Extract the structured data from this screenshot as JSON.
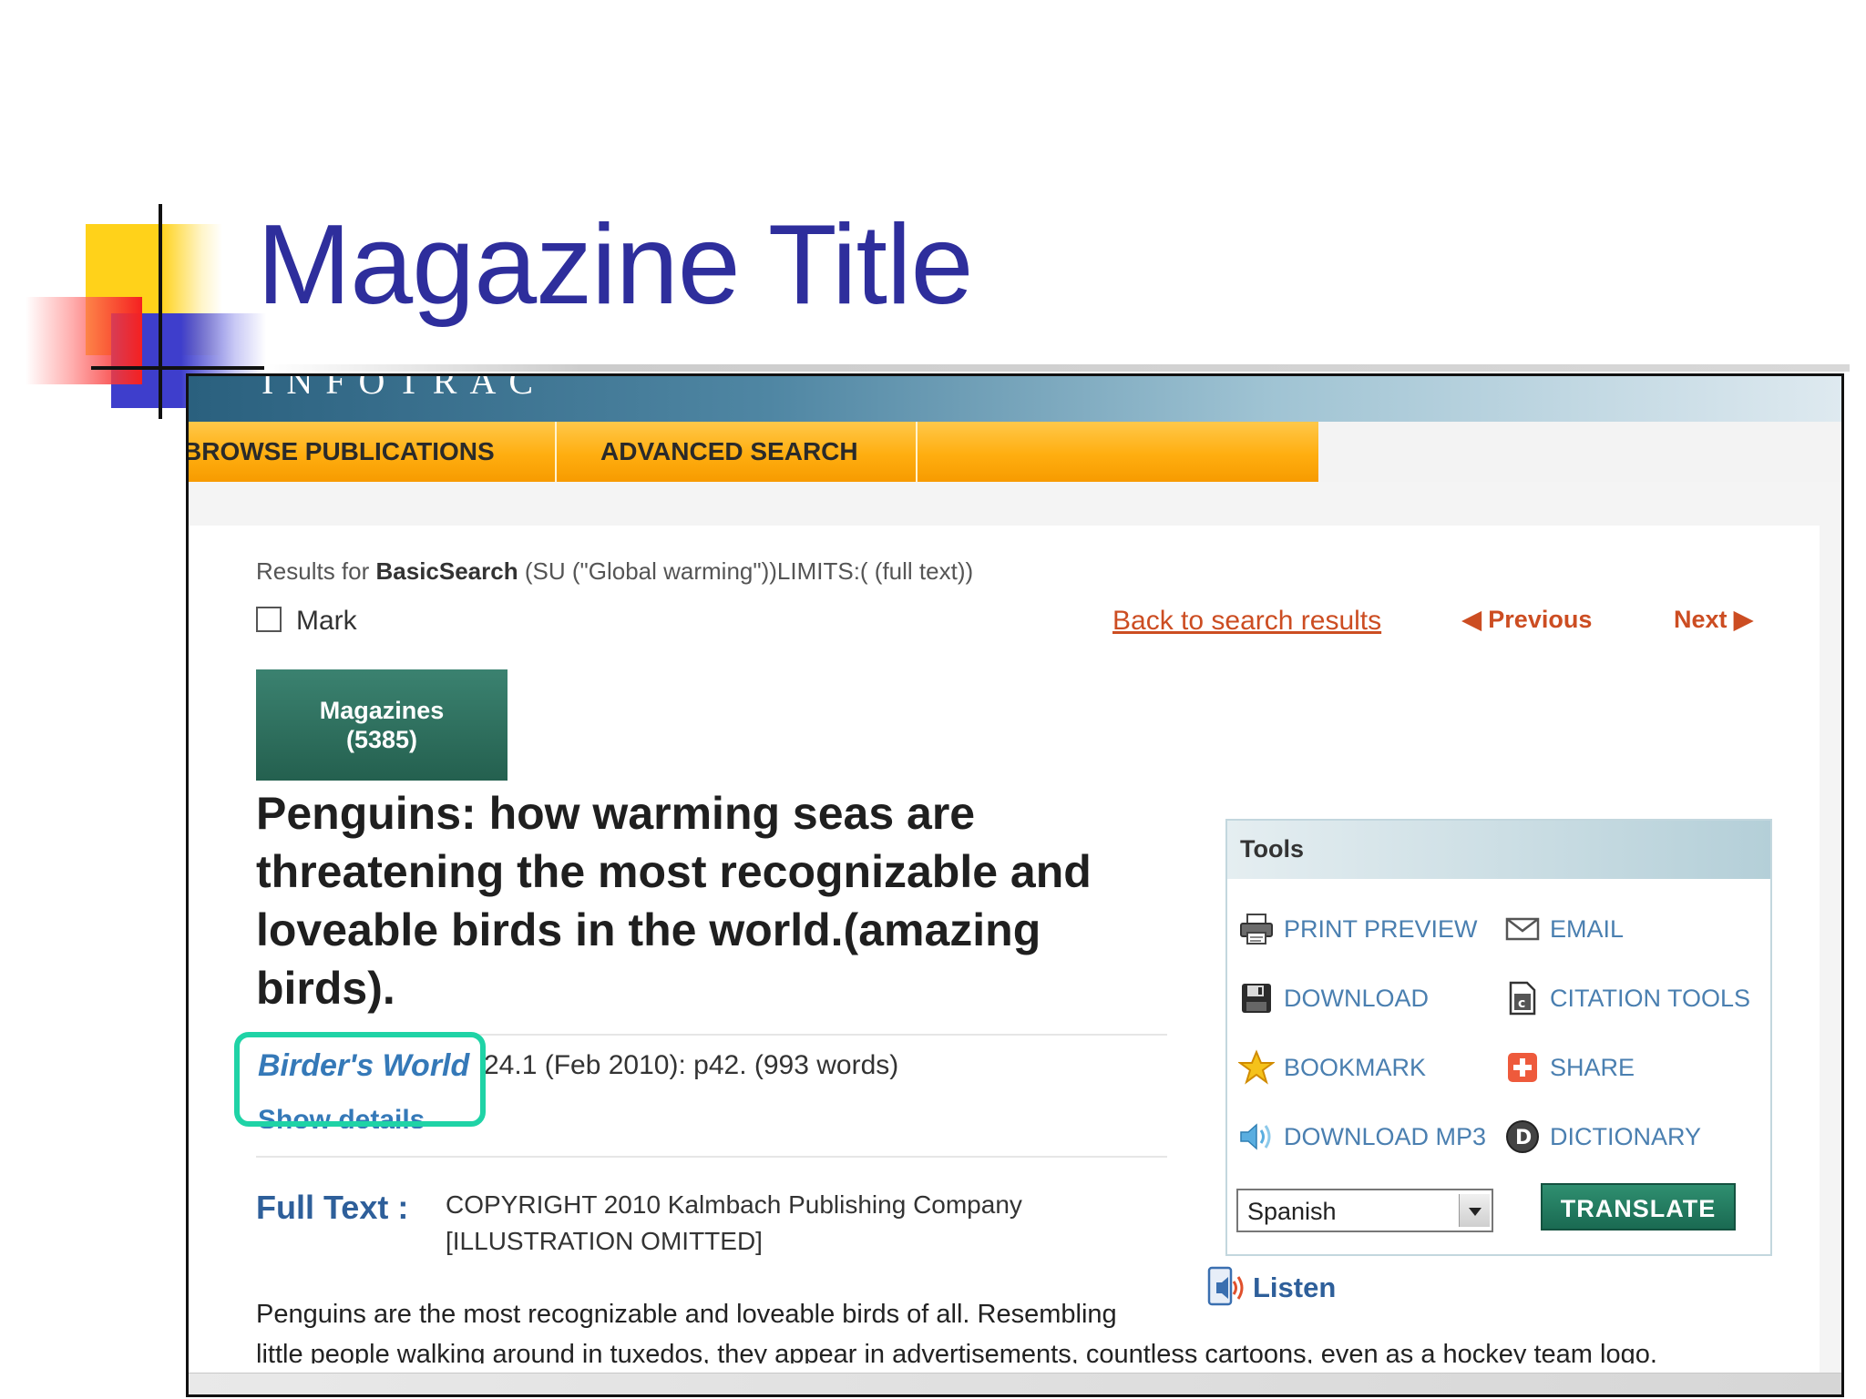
{
  "slide": {
    "title": "Magazine Title"
  },
  "app": {
    "logo": "INFOTRAC"
  },
  "nav": {
    "items": [
      {
        "label": "BROWSE PUBLICATIONS"
      },
      {
        "label": "ADVANCED SEARCH"
      }
    ]
  },
  "results": {
    "prefix": "Results for",
    "search_type": "BasicSearch",
    "query": "(SU (\"Global warming\"))LIMITS:( (full text))"
  },
  "mark": {
    "label": "Mark",
    "checked": false
  },
  "navigation": {
    "back": "Back to search results",
    "previous": "Previous",
    "next": "Next"
  },
  "tab": {
    "label": "Magazines",
    "count": "(5385)"
  },
  "article": {
    "title": "Penguins: how warming seas are threatening the most recognizable and loveable birds in the world.(amazing birds).",
    "publication": "Birder's World",
    "pub_info": "24.1 (Feb 2010): p42. (993 words)",
    "show_details": "Show details"
  },
  "fulltext": {
    "label": "Full Text :",
    "copyright": "COPYRIGHT 2010 Kalmbach Publishing Company",
    "illustration": "[ILLUSTRATION OMITTED]",
    "body_line_1": "Penguins are the most recognizable and loveable birds of all. Resembling",
    "body_line_2": "little people walking around in tuxedos, they appear in advertisements, countless cartoons, even as a hockey team logo."
  },
  "tools": {
    "title": "Tools",
    "items": [
      {
        "label": "PRINT PREVIEW",
        "icon": "printer-icon"
      },
      {
        "label": "EMAIL",
        "icon": "envelope-icon"
      },
      {
        "label": "DOWNLOAD",
        "icon": "floppy-disk-icon"
      },
      {
        "label": "CITATION TOOLS",
        "icon": "citation-document-icon"
      },
      {
        "label": "BOOKMARK",
        "icon": "star-icon"
      },
      {
        "label": "SHARE",
        "icon": "plus-icon"
      },
      {
        "label": "DOWNLOAD MP3",
        "icon": "speaker-icon"
      },
      {
        "label": "DICTIONARY",
        "icon": "dictionary-d-icon"
      }
    ],
    "language": "Spanish",
    "translate_label": "TRANSLATE"
  },
  "listen": {
    "label": "Listen"
  },
  "colors": {
    "slide_title": "#2e2e9c",
    "nav_orange": "#ffae10",
    "link_orange": "#cc4d22",
    "link_blue": "#3579b8",
    "teal_button": "#24604f",
    "highlight": "#1fd3a6"
  }
}
